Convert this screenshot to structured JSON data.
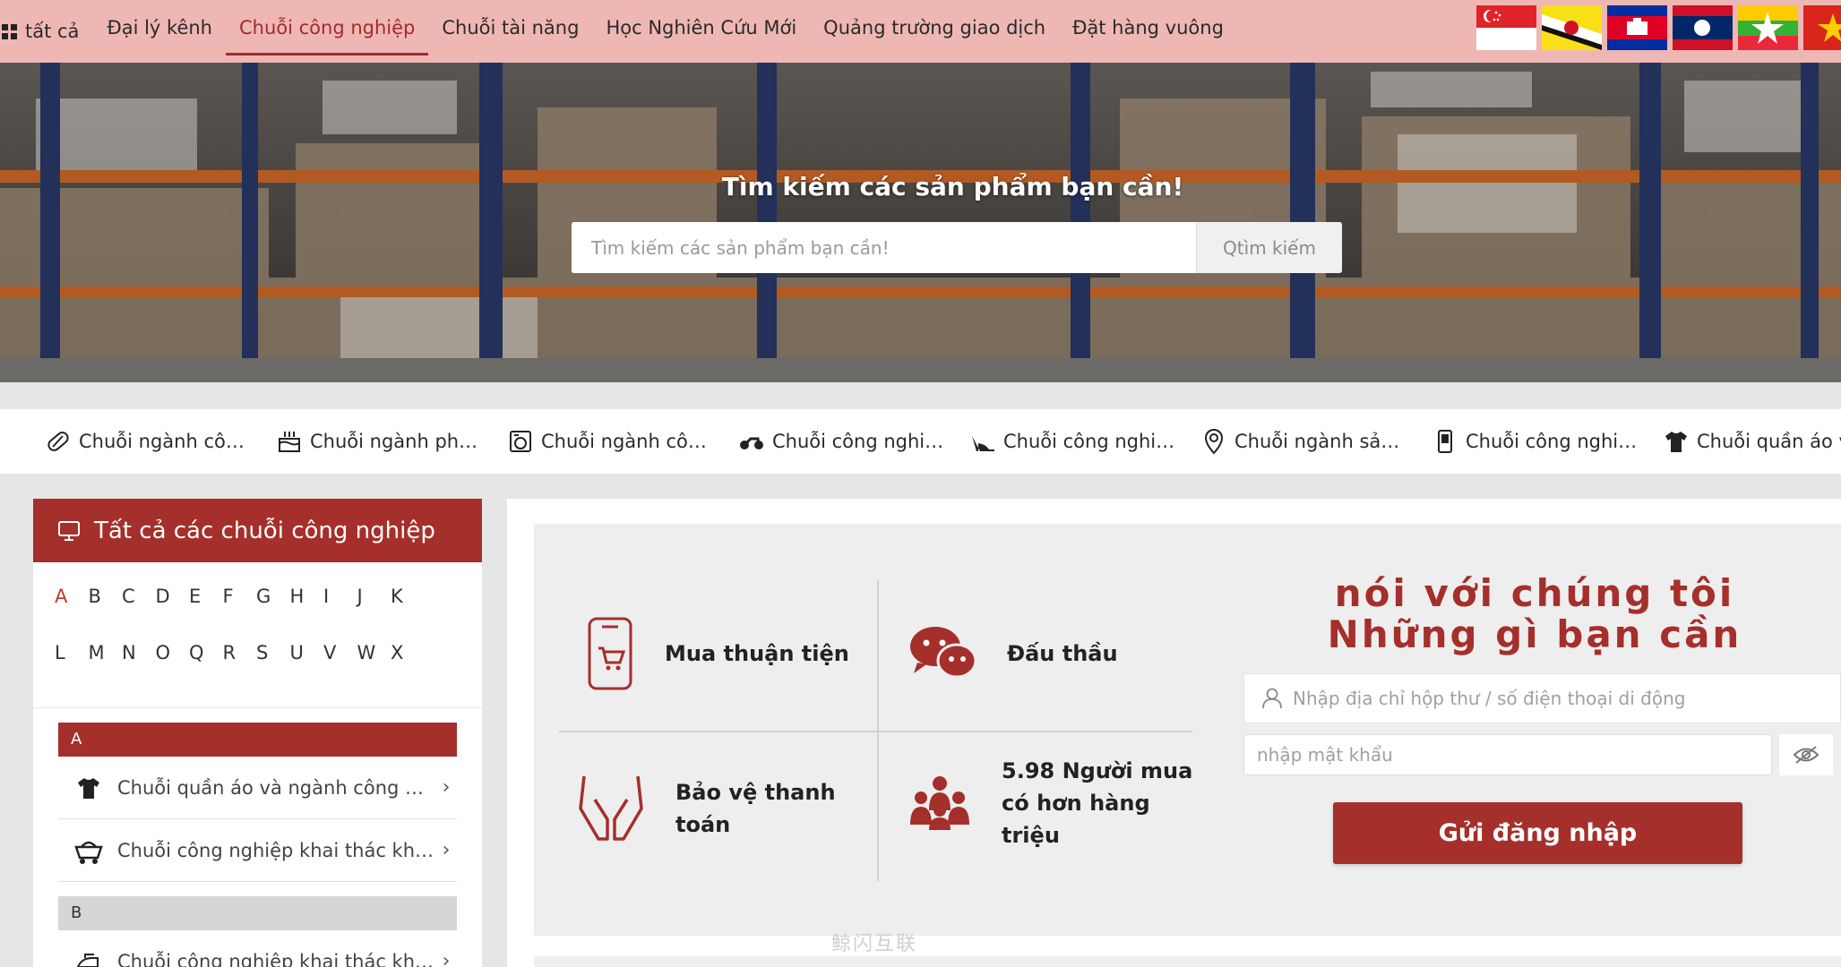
{
  "nav": {
    "all_label": "tất cả",
    "items": [
      "Đại lý kênh",
      "Chuỗi công nghiệp",
      "Chuỗi tài năng",
      "Học Nghiên Cứu Mới",
      "Quảng trường giao dịch",
      "Đặt hàng vuông"
    ],
    "active_index": 1
  },
  "flags": [
    "singapore-flag",
    "brunei-flag",
    "cambodia-flag",
    "laos-flag",
    "myanmar-flag",
    "vietnam-flag"
  ],
  "hero": {
    "title": "Tìm kiếm các sản phẩm bạn cần!",
    "search_placeholder": "Tìm kiếm các sản phẩm bạn cần!",
    "search_button": "Qtìm kiếm"
  },
  "categories": [
    {
      "icon": "pill-icon",
      "label": "Chuỗi ngành công nghiệp"
    },
    {
      "icon": "cake-icon",
      "label": "Chuỗi ngành phụ kiện"
    },
    {
      "icon": "appliance-icon",
      "label": "Chuỗi ngành công nghiệp"
    },
    {
      "icon": "motorcycle-icon",
      "label": "Chuỗi công nghiệp"
    },
    {
      "icon": "high-heel-icon",
      "label": "Chuỗi công nghiệp"
    },
    {
      "icon": "map-pin-icon",
      "label": "Chuỗi ngành sản xuất"
    },
    {
      "icon": "phone-icon",
      "label": "Chuỗi công nghiệp"
    },
    {
      "icon": "tshirt-icon",
      "label": "Chuỗi quần áo v"
    }
  ],
  "left_panel": {
    "title": "Tất cả các chuỗi công nghiệp",
    "letters": [
      "A",
      "B",
      "C",
      "D",
      "E",
      "F",
      "G",
      "H",
      "I",
      "J",
      "K",
      "L",
      "M",
      "N",
      "O",
      "Q",
      "R",
      "S",
      "U",
      "V",
      "W",
      "X"
    ],
    "active_letter": "A",
    "groups": [
      {
        "letter": "A",
        "items": [
          {
            "icon": "tshirt-icon",
            "label": "Chuỗi quần áo và ngành công nghiệp"
          },
          {
            "icon": "mining-cart-icon",
            "label": "Chuỗi công nghiệp khai thác khoáng sản"
          }
        ]
      },
      {
        "letter": "B",
        "items": [
          {
            "icon": "iron-icon",
            "label": "Chuỗi công nghiệp khai thác khoáng sản"
          }
        ]
      }
    ]
  },
  "features": [
    {
      "icon": "shopping-phone-icon",
      "label": "Mua thuận tiện"
    },
    {
      "icon": "chat-bubbles-icon",
      "label": "Đấu thầu"
    },
    {
      "icon": "hands-icon",
      "label": "Bảo vệ thanh toán"
    },
    {
      "icon": "people-icon",
      "label": "5.98 Người mua có hơn hàng triệu"
    }
  ],
  "login": {
    "title_line1": "nói với chúng tôi",
    "title_line2": "Những gì bạn cần",
    "account_placeholder": "Nhập địa chỉ hộp thư / số điện thoại di động",
    "password_placeholder": "nhập mật khẩu",
    "submit_label": "Gửi đăng nhập"
  },
  "watermark": "鲸闪互联",
  "colors": {
    "brand_red": "#a52f2b",
    "nav_bg": "#efb7b4",
    "page_bg": "#e6e6e6"
  }
}
